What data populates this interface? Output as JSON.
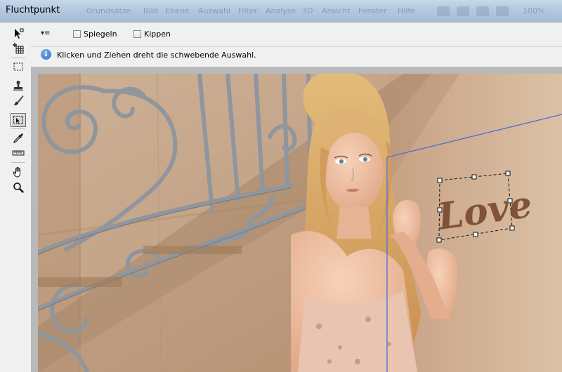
{
  "window": {
    "title": "Fluchtpunkt",
    "ghost_menu": [
      "Grundsätze",
      "Bild",
      "Ebene",
      "Auswahl",
      "Filter",
      "Analyse",
      "3D",
      "Ansicht",
      "Fenster",
      "Hilfe"
    ],
    "ghost_zoom": "100%"
  },
  "tools": [
    {
      "name": "edit-plane-tool",
      "icon": "arrow-plus-icon",
      "active": false
    },
    {
      "name": "create-plane-tool",
      "icon": "grid-plus-icon",
      "active": false
    },
    {
      "name": "marquee-tool",
      "icon": "dashed-rect-icon",
      "active": false
    },
    {
      "name": "stamp-tool",
      "icon": "stamp-icon",
      "active": false
    },
    {
      "name": "brush-tool",
      "icon": "brush-icon",
      "active": false
    },
    {
      "name": "transform-tool",
      "icon": "transform-icon",
      "active": true
    },
    {
      "name": "eyedropper-tool",
      "icon": "eyedropper-icon",
      "active": false
    },
    {
      "name": "measure-tool",
      "icon": "ruler-icon",
      "active": false
    },
    {
      "name": "hand-tool",
      "icon": "hand-icon",
      "active": false
    },
    {
      "name": "zoom-tool",
      "icon": "magnifier-icon",
      "active": false
    }
  ],
  "options": {
    "menu_glyph": "▾≡",
    "mirror_label": "Spiegeln",
    "flip_label": "Kippen",
    "mirror_checked": false,
    "flip_checked": false
  },
  "info": {
    "icon": "info-icon",
    "text": "Klicken und Ziehen dreht die schwebende Auswahl."
  },
  "canvas": {
    "overlay_text": "Love",
    "colors": {
      "wall": "#c9a98a",
      "railing": "#8c949c",
      "hair": "#d9a862",
      "skin": "#eab99a",
      "plane_outline": "#4a6fd8",
      "text": "#7a4a30"
    }
  }
}
